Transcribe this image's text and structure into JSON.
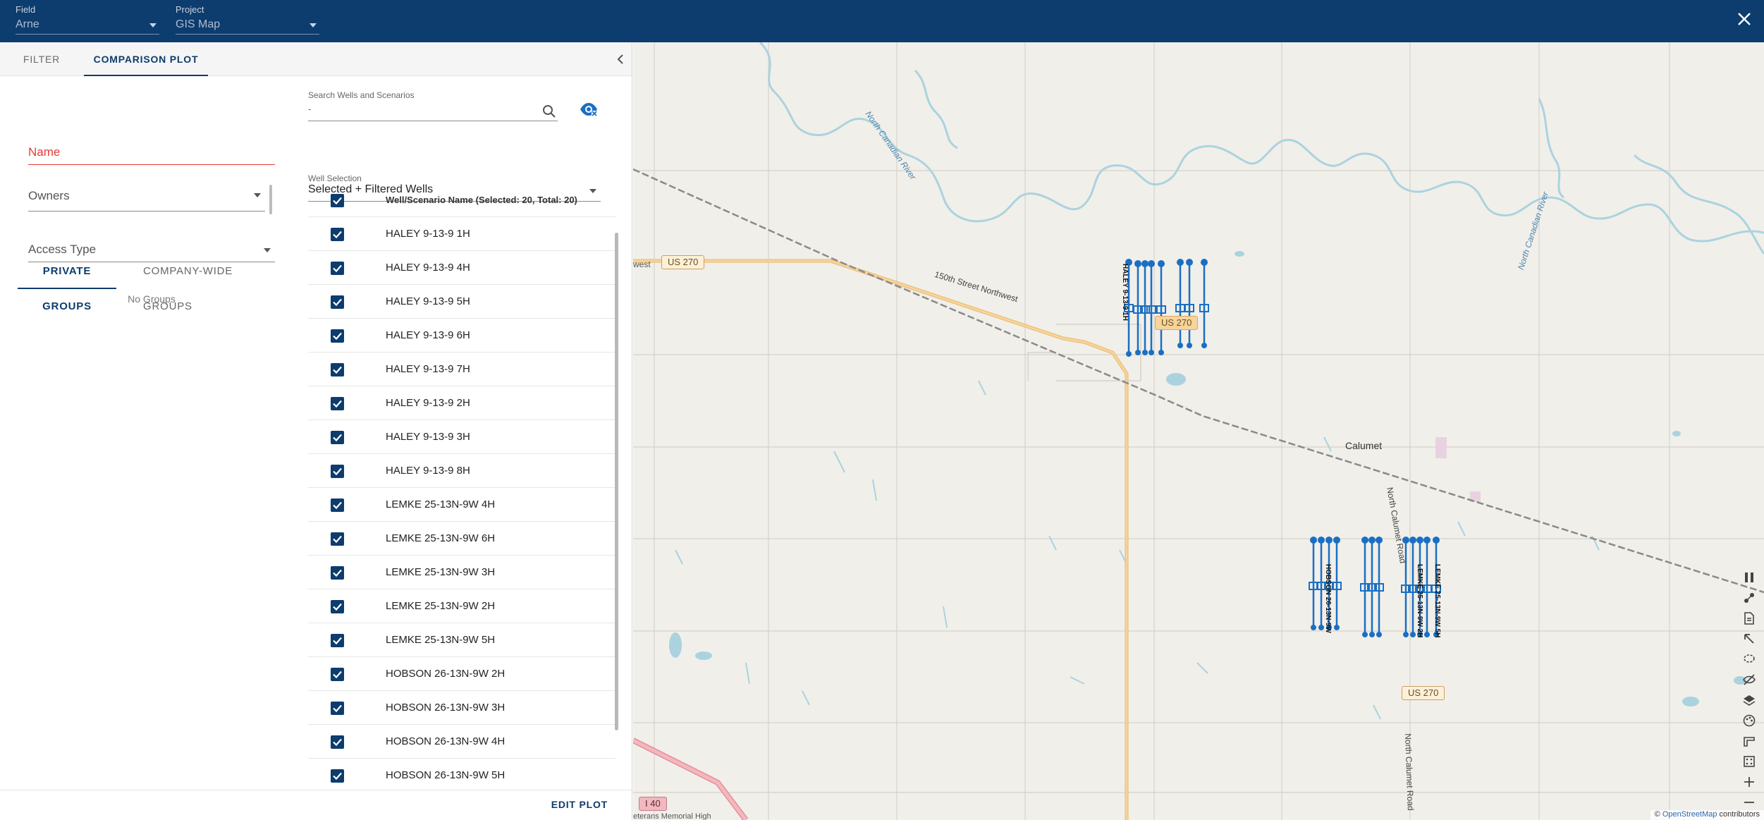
{
  "topbar": {
    "field_label": "Field",
    "field_value": "Arne",
    "project_label": "Project",
    "project_value": "GIS Map"
  },
  "tabs": {
    "filter": "FILTER",
    "comparison_plot": "COMPARISON PLOT"
  },
  "left_form": {
    "name_label": "Name",
    "owners_label": "Owners",
    "access_type_label": "Access Type",
    "groups_tabs": [
      "PRIVATE GROUPS",
      "COMPANY-WIDE GROUPS"
    ],
    "no_groups": "No Groups"
  },
  "search": {
    "label": "Search Wells and Scenarios",
    "value": "-"
  },
  "well_selection": {
    "label": "Well Selection",
    "value": "Selected + Filtered Wells"
  },
  "table": {
    "header": "Well/Scenario Name (Selected: 20, Total: 20)",
    "rows": [
      "HALEY 9-13-9 1H",
      "HALEY 9-13-9 4H",
      "HALEY 9-13-9 5H",
      "HALEY 9-13-9 6H",
      "HALEY 9-13-9 7H",
      "HALEY 9-13-9 2H",
      "HALEY 9-13-9 3H",
      "HALEY 9-13-9 8H",
      "LEMKE 25-13N-9W 4H",
      "LEMKE 25-13N-9W 6H",
      "LEMKE 25-13N-9W 3H",
      "LEMKE 25-13N-9W 2H",
      "LEMKE 25-13N-9W 5H",
      "HOBSON 26-13N-9W 2H",
      "HOBSON 26-13N-9W 3H",
      "HOBSON 26-13N-9W 4H",
      "HOBSON 26-13N-9W 5H"
    ]
  },
  "footer": {
    "edit_plot": "EDIT PLOT"
  },
  "map": {
    "labels": {
      "north_canadian_river_1": "North Canadian River",
      "north_canadian_river_2": "North Canadian River",
      "street_nw": "150th Street Northwest",
      "calumet": "Calumet",
      "north_calumet_road_1": "North Calumet Road",
      "north_calumet_road_2": "North Calumet Road",
      "us270_a": "US 270",
      "us270_b": "US 270",
      "us270_c": "US 270",
      "i40": "I 40",
      "west_stub": "west",
      "veterans": "eterans Memorial High",
      "well_label_a": "HALEY 9-13-9 1H",
      "well_label_b": "HOBSON 26-13N-9W",
      "well_label_c": "LEMKE 25-13N-9W 2H",
      "well_label_d": "LEMKE 25-13N-9W 5H"
    },
    "attribution_prefix": "© ",
    "attribution_link": "OpenStreetMap",
    "attribution_suffix": " contributors",
    "colors": {
      "water": "#aad3df",
      "road": "#f7d49c",
      "well": "#1a6fc4",
      "rail": "#8a8a8a"
    }
  },
  "tools": [
    "pause-icon",
    "points-icon",
    "document-icon",
    "arrow-icon",
    "lasso-icon",
    "hide-icon",
    "layers-icon",
    "palette-icon",
    "ruler-icon",
    "grid-icon",
    "zoom-in-icon",
    "zoom-out-icon"
  ]
}
